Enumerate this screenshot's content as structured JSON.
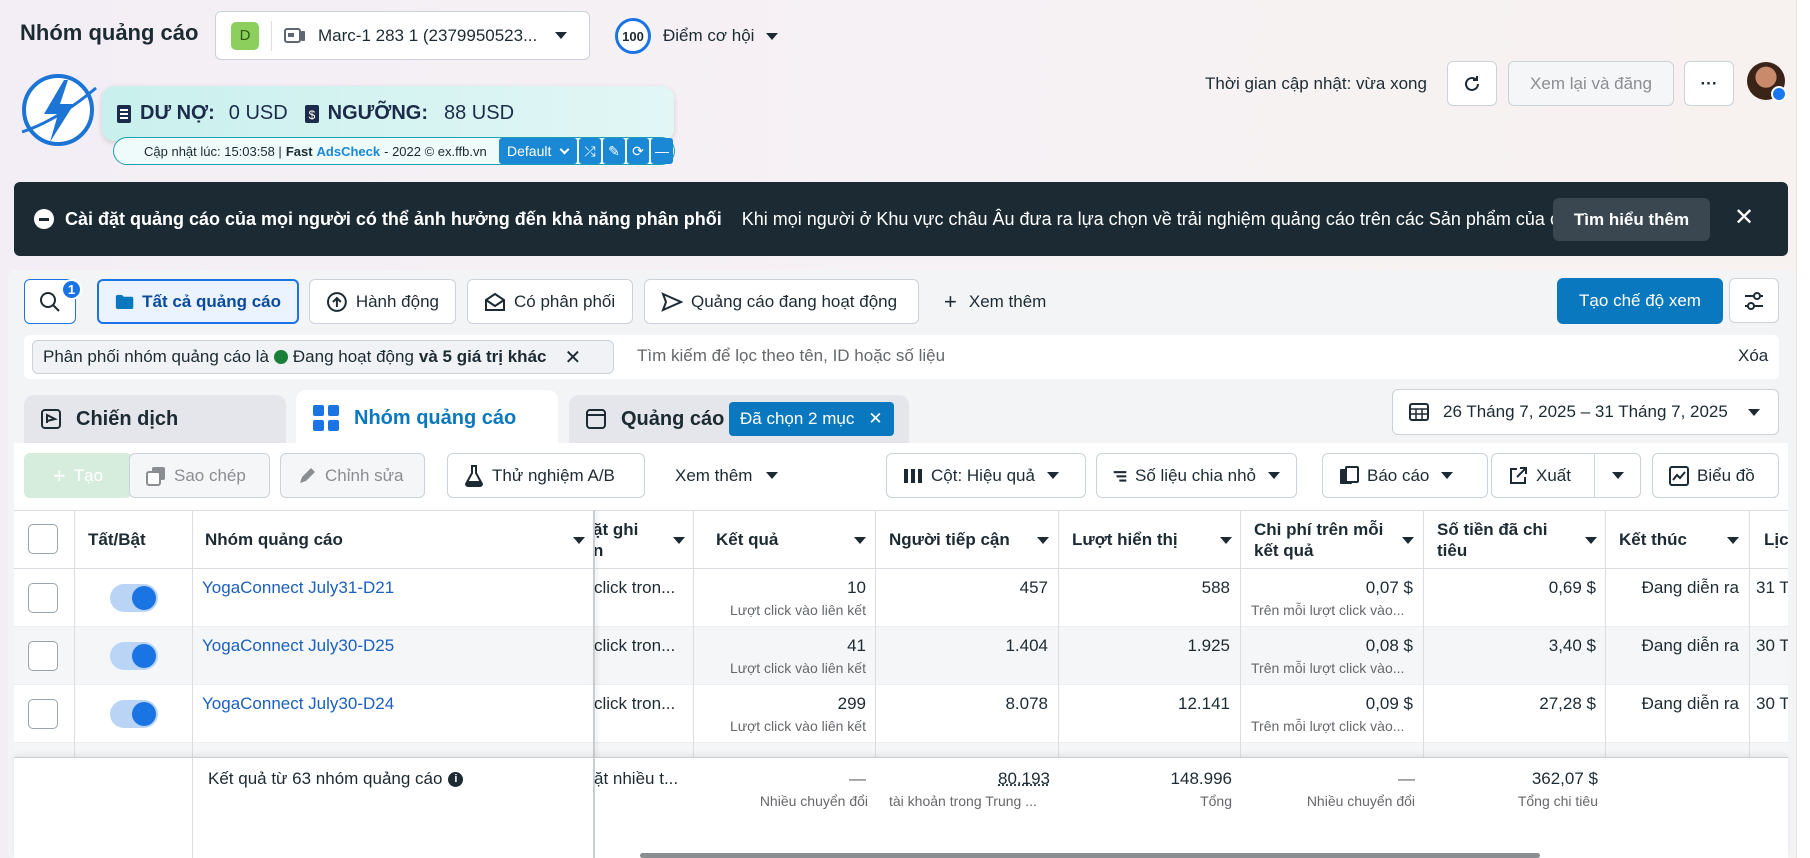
{
  "header": {
    "title": "Nhóm quảng cáo",
    "account_badge": "D",
    "account_name": "Marc-1 283 1 (2379950523...",
    "opportunity_score": "100",
    "opportunity_label": "Điểm cơ hội",
    "update_time": "Thời gian cập nhật: vừa xong",
    "review_publish": "Xem lại và đăng",
    "more": "···"
  },
  "extension": {
    "debt_label": "DƯ NỢ:",
    "debt_value": "0 USD",
    "threshold_label": "NGƯỠNG:",
    "threshold_value": "88 USD",
    "updated_prefix": "Cập nhật lúc: 15:03:58 |",
    "brand_fast": "Fast",
    "brand_ads": "AdsCheck",
    "brand_suffix": "- 2022 © ex.ffb.vn",
    "profile_select": "Default"
  },
  "banner": {
    "title": "Cài đặt quảng cáo của mọi người có thể ảnh hưởng đến khả năng phân phối",
    "text": "Khi mọi người ở Khu vực châu Âu đưa ra lựa chọn về trải nghiệm quảng cáo trên các Sản phẩm của chún...",
    "learn_more": "Tìm hiểu thêm"
  },
  "filters": {
    "search_badge": "1",
    "all_ads": "Tất cả quảng cáo",
    "actions": "Hành động",
    "delivering": "Có phân phối",
    "active_ads": "Quảng cáo đang hoạt động",
    "see_more": "Xem thêm",
    "create_view": "Tạo chế độ xem",
    "chip_prefix": "Phân phối nhóm quảng cáo là",
    "chip_active": "Đang hoạt động",
    "chip_more": "và 5 giá trị khác",
    "search_placeholder": "Tìm kiếm để lọc theo tên, ID hoặc số liệu",
    "clear": "Xóa"
  },
  "tabs": {
    "campaign": "Chiến dịch",
    "adset": "Nhóm quảng cáo",
    "ad": "Quảng cáo",
    "selected": "Đã chọn 2 mục",
    "date_range": "26 Tháng 7, 2025 – 31 Tháng 7, 2025"
  },
  "toolbar": {
    "create": "Tạo",
    "copy": "Sao chép",
    "edit": "Chỉnh sửa",
    "ab_test": "Thử nghiệm A/B",
    "see_more": "Xem thêm",
    "columns": "Cột: Hiệu quả",
    "breakdown": "Số liệu chia nhỏ",
    "reports": "Báo cáo",
    "export": "Xuất",
    "charts": "Biểu đồ"
  },
  "table": {
    "headers": {
      "toggle": "Tất/Bật",
      "name": "Nhóm quảng cáo",
      "bid_line1": "ặt ghi",
      "bid_line2": "n",
      "results": "Kết quả",
      "reach": "Người tiếp cận",
      "impressions": "Lượt hiển thị",
      "cpr_line1": "Chi phí trên mỗi",
      "cpr_line2": "kết quả",
      "spent_line1": "Số tiền đã chi",
      "spent_line2": "tiêu",
      "ends": "Kết thúc",
      "schedule": "Lịcl"
    },
    "rows": [
      {
        "name": "YogaConnect July31-D21",
        "bid": "click tron...",
        "result": "10",
        "result_type": "Lượt click vào liên kết",
        "reach": "457",
        "impressions": "588",
        "cpr": "0,07 $",
        "cpr_sub": "Trên mỗi lượt click vào...",
        "spent": "0,69 $",
        "ends": "Đang diễn ra",
        "schedule": "31 T"
      },
      {
        "name": "YogaConnect July30-D25",
        "bid": "click tron...",
        "result": "41",
        "result_type": "Lượt click vào liên kết",
        "reach": "1.404",
        "impressions": "1.925",
        "cpr": "0,08 $",
        "cpr_sub": "Trên mỗi lượt click vào...",
        "spent": "3,40 $",
        "ends": "Đang diễn ra",
        "schedule": "30 T"
      },
      {
        "name": "YogaConnect July30-D24",
        "bid": "click tron...",
        "result": "299",
        "result_type": "Lượt click vào liên kết",
        "reach": "8.078",
        "impressions": "12.141",
        "cpr": "0,09 $",
        "cpr_sub": "Trên mỗi lượt click vào...",
        "spent": "27,28 $",
        "ends": "Đang diễn ra",
        "schedule": "30 T"
      }
    ],
    "footer": {
      "label": "Kết quả từ 63 nhóm quảng cáo",
      "bid": "ặt nhiều t...",
      "result": "—",
      "result_sub": "Nhiều chuyển đổi",
      "reach": "80.193",
      "reach_sub": "tài khoản trong Trung ...",
      "impressions": "148.996",
      "impressions_sub": "Tổng",
      "cpr": "—",
      "cpr_sub": "Nhiều chuyển đổi",
      "spent": "362,07 $",
      "spent_sub": "Tổng chi tiêu"
    }
  },
  "colors": {
    "primary": "#0a78be",
    "link": "#1b5fbf",
    "banner": "#1c2b33",
    "toggle": "#1b74e4"
  }
}
